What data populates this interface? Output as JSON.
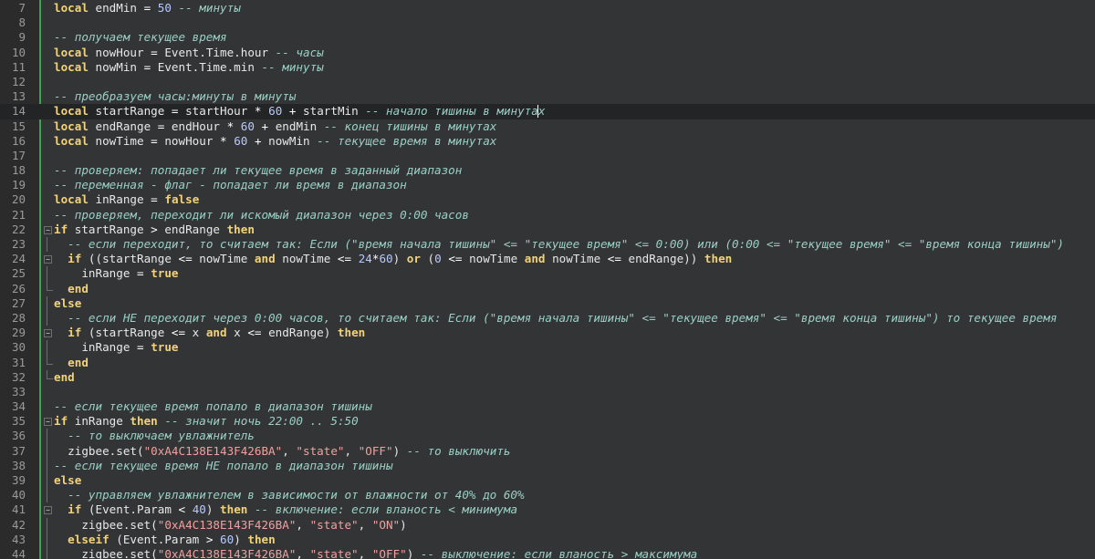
{
  "editor": {
    "lines": [
      {
        "n": "7",
        "segs": [
          [
            "kw",
            "local"
          ],
          [
            "t",
            " endMin "
          ],
          [
            "op",
            "="
          ],
          [
            "t",
            " "
          ],
          [
            "num",
            "50"
          ],
          [
            "t",
            " "
          ],
          [
            "cm",
            "-- минуты"
          ]
        ]
      },
      {
        "n": "8",
        "segs": []
      },
      {
        "n": "9",
        "segs": [
          [
            "cm",
            "-- получаем текущее время"
          ]
        ]
      },
      {
        "n": "10",
        "segs": [
          [
            "kw",
            "local"
          ],
          [
            "t",
            " nowHour "
          ],
          [
            "op",
            "="
          ],
          [
            "t",
            " Event.Time.hour "
          ],
          [
            "cm",
            "-- часы"
          ]
        ]
      },
      {
        "n": "11",
        "segs": [
          [
            "kw",
            "local"
          ],
          [
            "t",
            " nowMin "
          ],
          [
            "op",
            "="
          ],
          [
            "t",
            " Event.Time.min "
          ],
          [
            "cm",
            "-- минуты"
          ]
        ]
      },
      {
        "n": "12",
        "segs": []
      },
      {
        "n": "13",
        "segs": [
          [
            "cm",
            "-- преобразуем часы:минуты в минуты"
          ]
        ]
      },
      {
        "n": "14",
        "current": true,
        "segs": [
          [
            "kw",
            "local"
          ],
          [
            "t",
            " startRange "
          ],
          [
            "op",
            "="
          ],
          [
            "t",
            " startHour "
          ],
          [
            "op",
            "*"
          ],
          [
            "t",
            " "
          ],
          [
            "num",
            "60"
          ],
          [
            "t",
            " "
          ],
          [
            "op",
            "+"
          ],
          [
            "t",
            " startMin "
          ],
          [
            "cm",
            "-- начало тишины в минутах"
          ]
        ]
      },
      {
        "n": "15",
        "segs": [
          [
            "kw",
            "local"
          ],
          [
            "t",
            " endRange "
          ],
          [
            "op",
            "="
          ],
          [
            "t",
            " endHour "
          ],
          [
            "op",
            "*"
          ],
          [
            "t",
            " "
          ],
          [
            "num",
            "60"
          ],
          [
            "t",
            " "
          ],
          [
            "op",
            "+"
          ],
          [
            "t",
            " endMin "
          ],
          [
            "cm",
            "-- конец тишины в минутах"
          ]
        ]
      },
      {
        "n": "16",
        "segs": [
          [
            "kw",
            "local"
          ],
          [
            "t",
            " nowTime "
          ],
          [
            "op",
            "="
          ],
          [
            "t",
            " nowHour "
          ],
          [
            "op",
            "*"
          ],
          [
            "t",
            " "
          ],
          [
            "num",
            "60"
          ],
          [
            "t",
            " "
          ],
          [
            "op",
            "+"
          ],
          [
            "t",
            " nowMin "
          ],
          [
            "cm",
            "-- текущее время в минутах"
          ]
        ]
      },
      {
        "n": "17",
        "segs": []
      },
      {
        "n": "18",
        "segs": [
          [
            "cm",
            "-- проверяем: попадает ли текущее время в заданный диапазон"
          ]
        ]
      },
      {
        "n": "19",
        "segs": [
          [
            "cm",
            "-- переменная - флаг - попадает ли время в диапазон"
          ]
        ]
      },
      {
        "n": "20",
        "segs": [
          [
            "kw",
            "local"
          ],
          [
            "t",
            " inRange "
          ],
          [
            "op",
            "="
          ],
          [
            "t",
            " "
          ],
          [
            "kw",
            "false"
          ]
        ]
      },
      {
        "n": "21",
        "segs": [
          [
            "cm",
            "-- проверяем, переходит ли искомый диапазон через 0:00 часов"
          ]
        ]
      },
      {
        "n": "22",
        "fold": "open",
        "segs": [
          [
            "kw",
            "if"
          ],
          [
            "t",
            " startRange "
          ],
          [
            "op",
            ">"
          ],
          [
            "t",
            " endRange "
          ],
          [
            "kw",
            "then"
          ]
        ]
      },
      {
        "n": "23",
        "fold": "line",
        "segs": [
          [
            "t",
            "  "
          ],
          [
            "cm",
            "-- если переходит, то считаем так: Если (\"время начала тишины\" <= \"текущее время\" <= 0:00) или (0:00 <= \"текущее время\" <= \"время конца тишины\")"
          ]
        ]
      },
      {
        "n": "24",
        "fold": "open",
        "segs": [
          [
            "t",
            "  "
          ],
          [
            "kw",
            "if"
          ],
          [
            "t",
            " ((startRange "
          ],
          [
            "op",
            "<="
          ],
          [
            "t",
            " nowTime "
          ],
          [
            "kw",
            "and"
          ],
          [
            "t",
            " nowTime "
          ],
          [
            "op",
            "<="
          ],
          [
            "t",
            " "
          ],
          [
            "num",
            "24"
          ],
          [
            "op",
            "*"
          ],
          [
            "num",
            "60"
          ],
          [
            "t",
            ") "
          ],
          [
            "kw",
            "or"
          ],
          [
            "t",
            " ("
          ],
          [
            "num",
            "0"
          ],
          [
            "t",
            " "
          ],
          [
            "op",
            "<="
          ],
          [
            "t",
            " nowTime "
          ],
          [
            "kw",
            "and"
          ],
          [
            "t",
            " nowTime "
          ],
          [
            "op",
            "<="
          ],
          [
            "t",
            " endRange)) "
          ],
          [
            "kw",
            "then"
          ]
        ]
      },
      {
        "n": "25",
        "fold": "line",
        "segs": [
          [
            "t",
            "    inRange "
          ],
          [
            "op",
            "="
          ],
          [
            "t",
            " "
          ],
          [
            "kw",
            "true"
          ]
        ]
      },
      {
        "n": "26",
        "fold": "end",
        "segs": [
          [
            "t",
            "  "
          ],
          [
            "kw",
            "end"
          ]
        ]
      },
      {
        "n": "27",
        "fold": "line",
        "segs": [
          [
            "kw",
            "else"
          ]
        ]
      },
      {
        "n": "28",
        "fold": "line",
        "segs": [
          [
            "t",
            "  "
          ],
          [
            "cm",
            "-- если НЕ переходит через 0:00 часов, то считаем так: Если (\"время начала тишины\" <= \"текущее время\" <= \"время конца тишины\") то текущее время"
          ]
        ]
      },
      {
        "n": "29",
        "fold": "open",
        "segs": [
          [
            "t",
            "  "
          ],
          [
            "kw",
            "if"
          ],
          [
            "t",
            " (startRange "
          ],
          [
            "op",
            "<="
          ],
          [
            "t",
            " x "
          ],
          [
            "kw",
            "and"
          ],
          [
            "t",
            " x "
          ],
          [
            "op",
            "<="
          ],
          [
            "t",
            " endRange) "
          ],
          [
            "kw",
            "then"
          ]
        ]
      },
      {
        "n": "30",
        "fold": "line",
        "segs": [
          [
            "t",
            "    inRange "
          ],
          [
            "op",
            "="
          ],
          [
            "t",
            " "
          ],
          [
            "kw",
            "true"
          ]
        ]
      },
      {
        "n": "31",
        "fold": "end",
        "segs": [
          [
            "t",
            "  "
          ],
          [
            "kw",
            "end"
          ]
        ]
      },
      {
        "n": "32",
        "fold": "end",
        "segs": [
          [
            "kw",
            "end"
          ]
        ]
      },
      {
        "n": "33",
        "segs": []
      },
      {
        "n": "34",
        "segs": [
          [
            "cm",
            "-- если текущее время попало в диапазон тишины"
          ]
        ]
      },
      {
        "n": "35",
        "fold": "open",
        "segs": [
          [
            "kw",
            "if"
          ],
          [
            "t",
            " inRange "
          ],
          [
            "kw",
            "then"
          ],
          [
            "t",
            " "
          ],
          [
            "cm",
            "-- значит ночь 22:00 .. 5:50"
          ]
        ]
      },
      {
        "n": "36",
        "fold": "line",
        "segs": [
          [
            "t",
            "  "
          ],
          [
            "cm",
            "-- то выключаем увлажнитель"
          ]
        ]
      },
      {
        "n": "37",
        "fold": "line",
        "segs": [
          [
            "t",
            "  zigbee.set("
          ],
          [
            "str",
            "\"0xA4C138E143F426BA\""
          ],
          [
            "t",
            ", "
          ],
          [
            "str",
            "\"state\""
          ],
          [
            "t",
            ", "
          ],
          [
            "str",
            "\"OFF\""
          ],
          [
            "t",
            ") "
          ],
          [
            "cm",
            "-- то выключить"
          ]
        ]
      },
      {
        "n": "38",
        "fold": "line",
        "segs": [
          [
            "cm",
            "-- если текущее время НЕ попало в диапазон тишины"
          ]
        ]
      },
      {
        "n": "39",
        "fold": "line",
        "segs": [
          [
            "kw",
            "else"
          ]
        ]
      },
      {
        "n": "40",
        "fold": "line",
        "segs": [
          [
            "t",
            "  "
          ],
          [
            "cm",
            "-- управляем увлажнителем в зависимости от влажности от 40% до 60%"
          ]
        ]
      },
      {
        "n": "41",
        "fold": "open",
        "segs": [
          [
            "t",
            "  "
          ],
          [
            "kw",
            "if"
          ],
          [
            "t",
            " (Event.Param "
          ],
          [
            "op",
            "<"
          ],
          [
            "t",
            " "
          ],
          [
            "num",
            "40"
          ],
          [
            "t",
            ") "
          ],
          [
            "kw",
            "then"
          ],
          [
            "t",
            " "
          ],
          [
            "cm",
            "-- включение: если вланость < минимума"
          ]
        ]
      },
      {
        "n": "42",
        "fold": "line",
        "segs": [
          [
            "t",
            "    zigbee.set("
          ],
          [
            "str",
            "\"0xA4C138E143F426BA\""
          ],
          [
            "t",
            ", "
          ],
          [
            "str",
            "\"state\""
          ],
          [
            "t",
            ", "
          ],
          [
            "str",
            "\"ON\""
          ],
          [
            "t",
            ")"
          ]
        ]
      },
      {
        "n": "43",
        "fold": "line",
        "segs": [
          [
            "t",
            "  "
          ],
          [
            "kw",
            "elseif"
          ],
          [
            "t",
            " (Event.Param "
          ],
          [
            "op",
            ">"
          ],
          [
            "t",
            " "
          ],
          [
            "num",
            "60"
          ],
          [
            "t",
            ") "
          ],
          [
            "kw",
            "then"
          ]
        ]
      },
      {
        "n": "44",
        "fold": "line",
        "segs": [
          [
            "t",
            "    zigbee.set("
          ],
          [
            "str",
            "\"0xA4C138E143F426BA\""
          ],
          [
            "t",
            ", "
          ],
          [
            "str",
            "\"state\""
          ],
          [
            "t",
            ", "
          ],
          [
            "str",
            "\"OFF\""
          ],
          [
            "t",
            ") "
          ],
          [
            "cm",
            "-- выключение: если вланость > максимума"
          ]
        ]
      }
    ]
  }
}
